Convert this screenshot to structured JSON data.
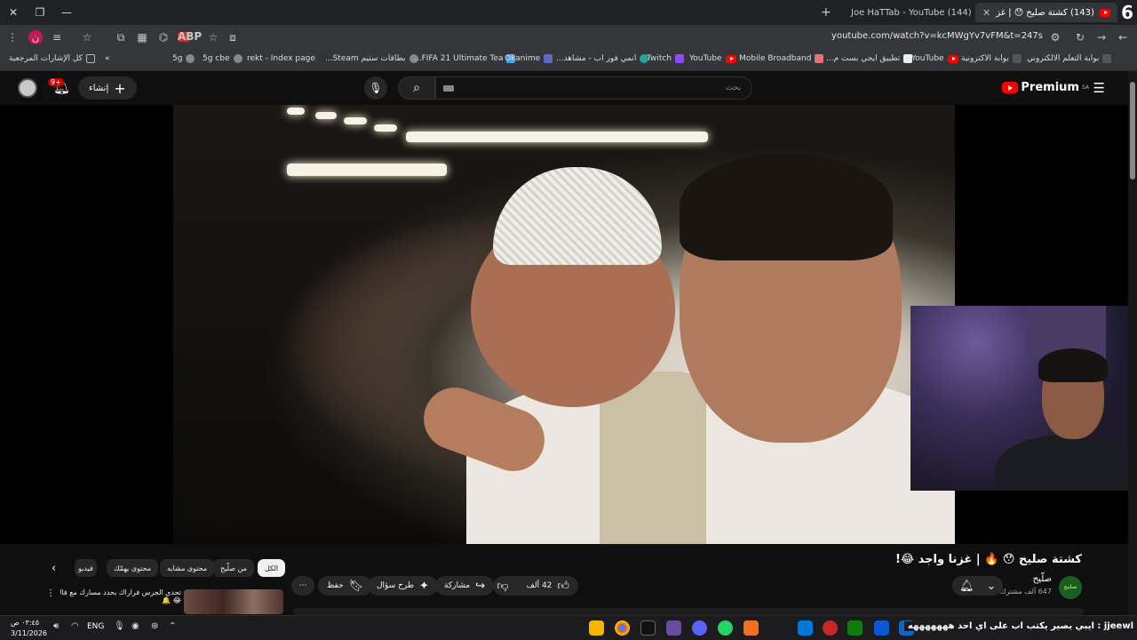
{
  "browser": {
    "tab_count": "6",
    "tabs": [
      {
        "title": "(143) كشتة صليح 😯 | غز"
      },
      {
        "title": "(144) Joe HaTTab - YouTube"
      }
    ],
    "url": "youtube.com/watch?v=kcMWgYv7vFM&t=247s",
    "ext_badge": "ن",
    "abp_label": "ABP",
    "bookmarks": [
      "بوابة التعلم الالكتروني",
      "بوابة الاكترونية",
      "YouTube",
      "تطبيق ايجي بست م...",
      "Mobile Broadband",
      "YouTube",
      "Twitch",
      "انمي فور اب - مشاهد...",
      "Okanime",
      "FIFA 21 Ultimate Tea...",
      "بطاقات ستيم Steam...",
      "rekt - Index page",
      "5g cbe",
      "5g"
    ],
    "bookmarks_overflow": "»",
    "all_bookmarks": "كل الإشارات المرجعية"
  },
  "youtube": {
    "logo_text": "Premium",
    "logo_region": "SA",
    "search_placeholder": "بحث",
    "create_label": "إنشاء",
    "notifications": "9+",
    "video": {
      "title": "كشتة صليح 😯 🔥 | غزنا واجد 😂!",
      "channel": "صلّيح",
      "channel_avatar_text": "صليح",
      "subscribers": "647 ألف مشترك",
      "likes": "42 ألف",
      "share_label": "مشاركة",
      "ask_label": "طرح سؤال",
      "save_label": "حفظ"
    },
    "chips": [
      "الكل",
      "من صلّيح",
      "محتوى مشابه",
      "محتوى يهمّك",
      "فيديو"
    ],
    "suggestion": {
      "title": "تحدي الجرس فراراك بحدد مسارك مع فالكونز",
      "title_line2": "😂 🔔"
    }
  },
  "taskbar": {
    "time": "٠٣:٤٥ ص",
    "date": "3/11/2026",
    "lang": "ENG",
    "ticker": "jjeewl : ايبي يصير يكتب اب على اي احد هههههههه"
  }
}
